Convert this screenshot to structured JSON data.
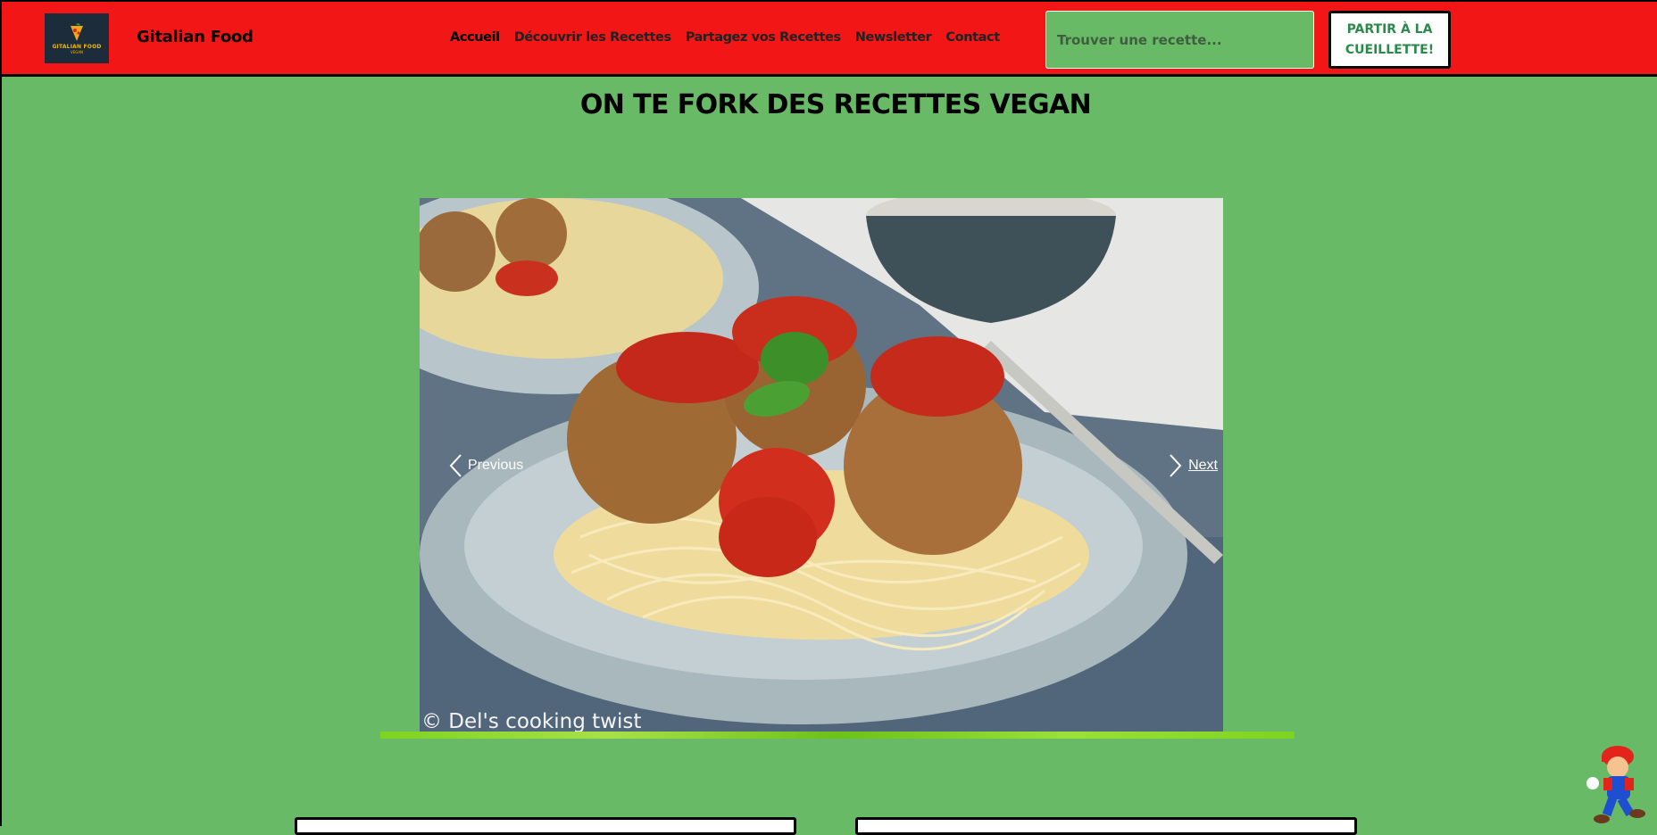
{
  "logo": {
    "line1": "GITALIAN FOOD",
    "line2": "VEGAN"
  },
  "brand": "Gitalian Food",
  "nav": [
    {
      "label": "Accueil",
      "active": true
    },
    {
      "label": "Découvrir les Recettes"
    },
    {
      "label": "Partagez vos Recettes"
    },
    {
      "label": "Newsletter"
    },
    {
      "label": "Contact"
    }
  ],
  "search": {
    "placeholder": "Trouver une recette..."
  },
  "cta": {
    "label": "Partir à la cueillette!"
  },
  "page_title": "ON TE FORK DES RECETTES VEGAN",
  "carousel": {
    "credit": "© Del's cooking twist",
    "prev_label": "Previous",
    "next_label": "Next"
  },
  "colors": {
    "navbar": "#f31616",
    "page": "#69ba66",
    "cta_text": "#2a8a4a"
  }
}
